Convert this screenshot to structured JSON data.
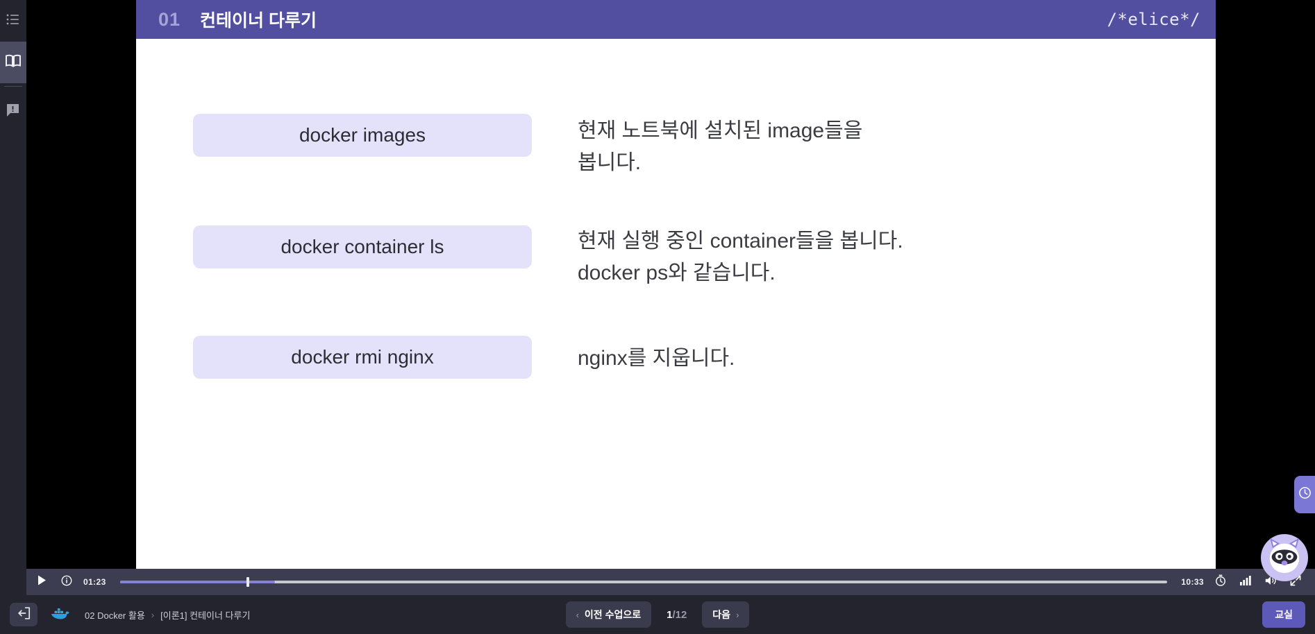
{
  "sidebar": {
    "items": [
      {
        "name": "list-menu",
        "icon": "list-icon",
        "active": false
      },
      {
        "name": "course-book",
        "icon": "book-icon",
        "active": true
      },
      {
        "name": "qna-notice",
        "icon": "speech-bubble-alert-icon",
        "active": false
      }
    ]
  },
  "slide": {
    "header": {
      "number": "01",
      "title": "컨테이너 다루기",
      "logo": "/*elice*/"
    },
    "rows": [
      {
        "command": "docker images",
        "description": "현재 노트북에 설치된 image들을\n봅니다."
      },
      {
        "command": "docker container ls",
        "description": "현재 실행 중인 container들을 봅니다.\ndocker ps와 같습니다."
      },
      {
        "command": "docker rmi nginx",
        "description": "nginx를 지웁니다."
      }
    ]
  },
  "side_tab": {
    "icon": "clock-icon"
  },
  "mascot": {
    "icon": "raccoon-mascot-avatar"
  },
  "player": {
    "play_icon": "play-icon",
    "info_icon": "info-circle-icon",
    "current_time": "01:23",
    "duration": "10:33",
    "progress_percent": 14.8,
    "playhead_percent": 12.1,
    "speed_icon": "stopwatch-icon",
    "quality_icon": "signal-bars-icon",
    "volume_icon": "volume-icon",
    "fullscreen_icon": "expand-icon"
  },
  "bottom_bar": {
    "exit_icon": "exit-door-icon",
    "brand_icon": "docker-whale-icon",
    "breadcrumb": [
      "02 Docker 활용",
      "[이론1] 컨테이너 다루기"
    ],
    "breadcrumb_separator": "›",
    "prev_label": "이전 수업으로",
    "prev_chevron": "‹",
    "next_label": "다음",
    "next_chevron": "›",
    "page_current": "1",
    "page_total": "/12",
    "classroom_label": "교실"
  },
  "colors": {
    "slide_header": "#524fa1",
    "header_accent": "#9a97d6",
    "command_box": "#e4e2fa",
    "progress_fill": "#8481d6",
    "classroom_button": "#5d59b8",
    "chrome_dark": "#24242e",
    "player_bar": "#3d3d52"
  }
}
